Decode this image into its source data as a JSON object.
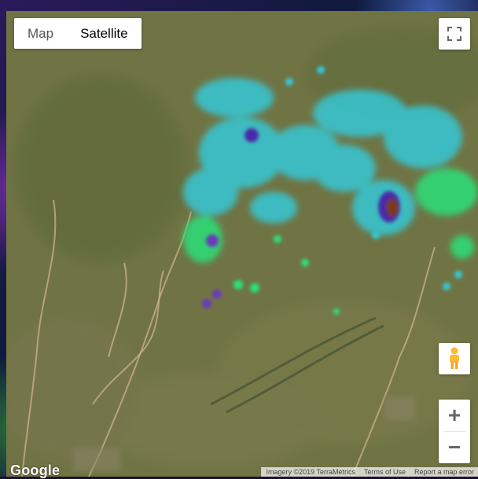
{
  "map": {
    "type_buttons": {
      "map": "Map",
      "satellite": "Satellite"
    },
    "selected_type": "Satellite",
    "fullscreen_icon": "fullscreen-icon",
    "pegman_icon": "pegman-icon",
    "zoom_in": "+",
    "zoom_out": "−",
    "logo": "Google",
    "attribution": {
      "imagery": "Imagery ©2019 TerraMetrics",
      "terms": "Terms of Use",
      "report": "Report a map error"
    },
    "heatmap_colors": {
      "low": "#2be07a",
      "mid": "#35c8d6",
      "high": "#4a2aa8",
      "peak": "#7a3a1a"
    }
  }
}
